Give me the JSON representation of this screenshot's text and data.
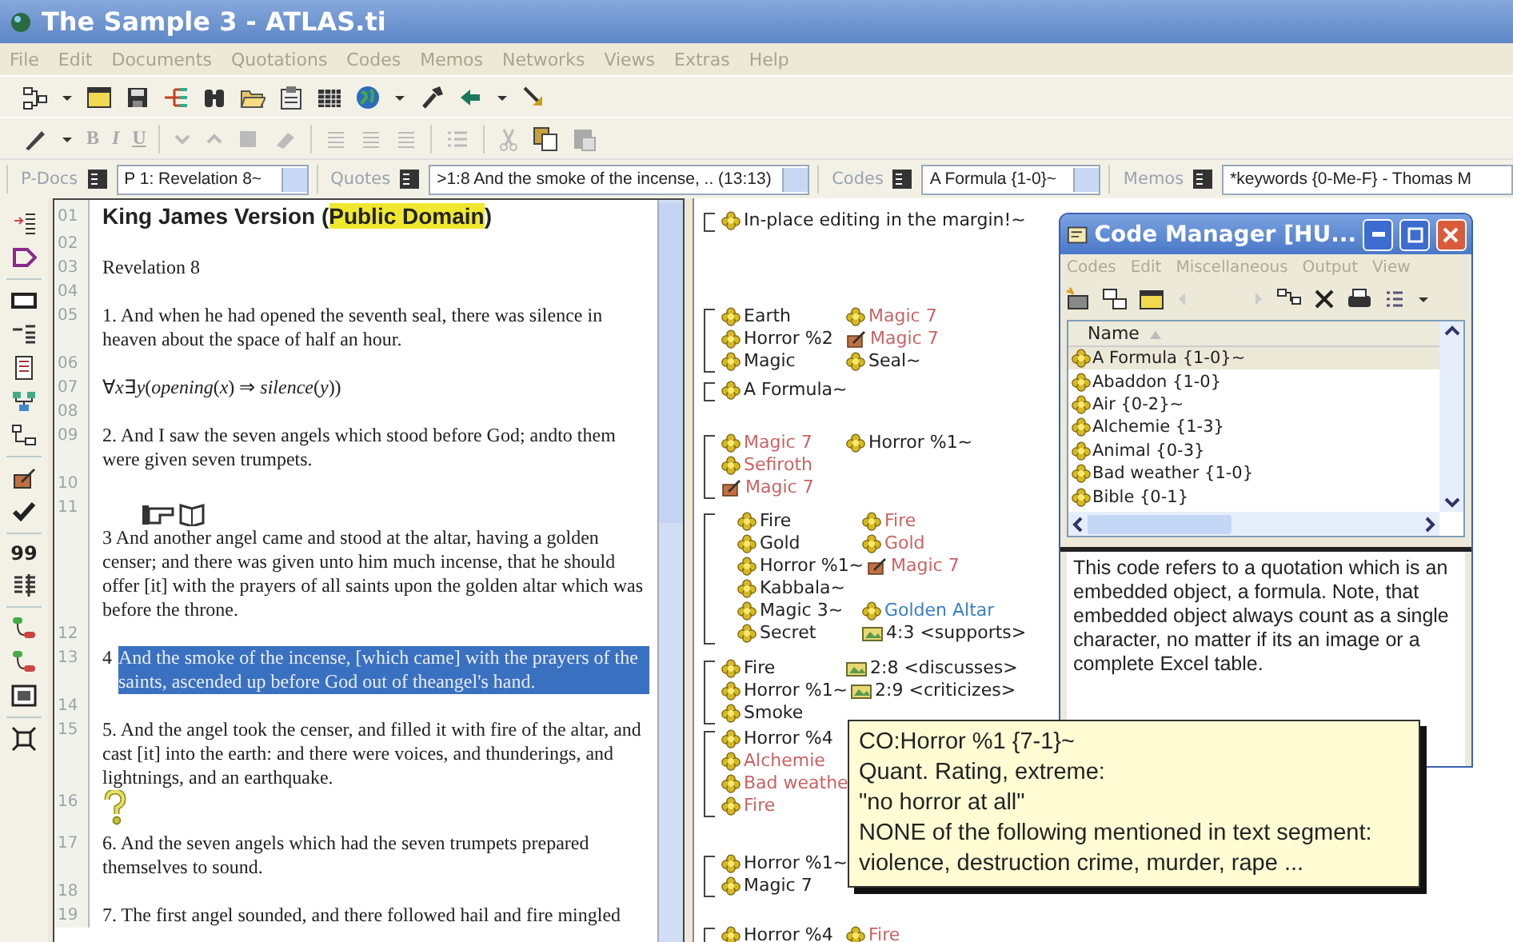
{
  "window": {
    "title": "The Sample 3 - ATLAS.ti"
  },
  "menu": [
    "File",
    "Edit",
    "Documents",
    "Quotations",
    "Codes",
    "Memos",
    "Networks",
    "Views",
    "Extras",
    "Help"
  ],
  "format_buttons": [
    "B",
    "I",
    "U"
  ],
  "selectors": [
    {
      "label": "P-Docs",
      "value": "P 1: Revelation 8~"
    },
    {
      "label": "Quotes",
      "value": ">1:8 And the smoke of the incense, .. (13:13)"
    },
    {
      "label": "Codes",
      "value": "A Formula {1-0}~"
    },
    {
      "label": "Memos",
      "value": "*keywords {0-Me-F} - Thomas M"
    }
  ],
  "side_toolbar_label": "99",
  "document": {
    "lines": [
      {
        "number": "01",
        "kind": "heading",
        "text": "King James Version (",
        "highlight": "Public Domain",
        "text_after": ")"
      },
      {
        "number": "02",
        "kind": "blank"
      },
      {
        "number": "03",
        "kind": "text",
        "text": "Revelation  8"
      },
      {
        "number": "04",
        "kind": "blank"
      },
      {
        "number": "05",
        "kind": "text",
        "text": "1. And when he had opened the seventh seal, there was silence in heaven about the space of half an hour."
      },
      {
        "number": "06",
        "kind": "blank"
      },
      {
        "number": "07",
        "kind": "formula",
        "text": "∀*x*∃*y*(*opening*(*x*) ⇒ *silence*(*y*))"
      },
      {
        "number": "08",
        "kind": "blank"
      },
      {
        "number": "09",
        "kind": "text",
        "text": "2. And I saw the seven angels which stood before God; andto them were given seven trumpets."
      },
      {
        "number": "10",
        "kind": "blank"
      },
      {
        "number": "11",
        "kind": "embedded",
        "verse": "3",
        "text": "And another angel came and stood at the altar, having a golden censer; and there was given unto him much incense, that he should offer [it] with the prayers of all saints upon the golden altar which was before the throne."
      },
      {
        "number": "12",
        "kind": "blank"
      },
      {
        "number": "13",
        "kind": "quotation",
        "verse": "4",
        "text": "And the smoke of the incense, [which came] with the prayers of the saints, ascended up before God out of theangel's hand.",
        "selected": true
      },
      {
        "number": "14",
        "kind": "blank"
      },
      {
        "number": "15",
        "kind": "text",
        "text": "5. And the angel took the censer, and filled it with fire of the altar, and cast [it] into the earth: and there were voices, and thunderings, and lightnings, and an earthquake."
      },
      {
        "number": "16",
        "kind": "icon"
      },
      {
        "number": "17",
        "kind": "text",
        "text": "6. And the seven angels which had the seven trumpets prepared themselves to sound."
      },
      {
        "number": "18",
        "kind": "blank"
      },
      {
        "number": "19",
        "kind": "text",
        "text": "7. The first angel sounded, and there followed hail and fire mingled"
      }
    ]
  },
  "margin": {
    "groups": [
      {
        "rows": [
          [
            {
              "kind": "code",
              "label": "In-place editing in the margin!~",
              "color": "#222222"
            }
          ]
        ]
      },
      {
        "rows": [
          [
            {
              "kind": "code",
              "label": "Earth",
              "color": "#222222"
            },
            {
              "kind": "code",
              "label": "Magic 7",
              "color": "#c86464"
            }
          ],
          [
            {
              "kind": "code",
              "label": "Horror %2",
              "color": "#222222"
            },
            {
              "kind": "memo",
              "label": "Magic 7",
              "color": "#c86464"
            }
          ],
          [
            {
              "kind": "code",
              "label": "Magic",
              "color": "#222222"
            },
            {
              "kind": "code",
              "label": "Seal~",
              "color": "#222222"
            }
          ]
        ]
      },
      {
        "rows": [
          [
            {
              "kind": "code",
              "label": "A Formula~",
              "color": "#222222"
            }
          ]
        ]
      },
      {
        "rows": [
          [
            {
              "kind": "code",
              "label": "Magic 7",
              "color": "#c86464"
            },
            {
              "kind": "code",
              "label": "Horror %1~",
              "color": "#222222"
            }
          ],
          [
            {
              "kind": "code",
              "label": "Sefiroth",
              "color": "#c86464"
            }
          ],
          [
            {
              "kind": "memo",
              "label": "Magic 7",
              "color": "#c86464"
            }
          ]
        ]
      },
      {
        "rows": [
          [
            {
              "kind": "code",
              "label": "Fire",
              "color": "#222222"
            },
            {
              "kind": "code",
              "label": "Fire",
              "color": "#c86464"
            }
          ],
          [
            {
              "kind": "code",
              "label": "Gold",
              "color": "#222222"
            },
            {
              "kind": "code",
              "label": "Gold",
              "color": "#c86464"
            }
          ],
          [
            {
              "kind": "code",
              "label": "Horror %1~",
              "color": "#222222"
            },
            {
              "kind": "memo",
              "label": "Magic 7",
              "color": "#c86464"
            }
          ],
          [
            {
              "kind": "code",
              "label": "Kabbala~",
              "color": "#222222"
            }
          ],
          [
            {
              "kind": "code",
              "label": "Magic 3~",
              "color": "#222222"
            },
            {
              "kind": "code",
              "label": "Golden Altar",
              "color": "#3b7fc4"
            }
          ],
          [
            {
              "kind": "code",
              "label": "Secret",
              "color": "#222222"
            },
            {
              "kind": "link",
              "label": "4:3 <supports>",
              "color": "#222222"
            }
          ]
        ]
      },
      {
        "rows": [
          [
            {
              "kind": "code",
              "label": "Fire",
              "color": "#222222"
            },
            {
              "kind": "link",
              "label": "2:8 <discusses>",
              "color": "#222222"
            }
          ],
          [
            {
              "kind": "code",
              "label": "Horror %1~",
              "color": "#222222"
            },
            {
              "kind": "link",
              "label": "2:9 <criticizes>",
              "color": "#222222"
            }
          ],
          [
            {
              "kind": "code",
              "label": "Smoke",
              "color": "#222222"
            }
          ]
        ]
      },
      {
        "rows": [
          [
            {
              "kind": "code",
              "label": "Horror %4",
              "color": "#222222"
            }
          ],
          [
            {
              "kind": "code",
              "label": "Alchemie",
              "color": "#c86464"
            }
          ],
          [
            {
              "kind": "code",
              "label": "Bad weathe",
              "color": "#c86464"
            }
          ],
          [
            {
              "kind": "code",
              "label": "Fire",
              "color": "#c86464"
            }
          ]
        ]
      },
      {
        "rows": [
          [
            {
              "kind": "code",
              "label": "Horror %1~",
              "color": "#222222"
            }
          ],
          [
            {
              "kind": "code",
              "label": "Magic 7",
              "color": "#222222"
            }
          ]
        ]
      },
      {
        "rows": [
          [
            {
              "kind": "code",
              "label": "Horror %4",
              "color": "#222222"
            },
            {
              "kind": "code",
              "label": "Fire",
              "color": "#c86464"
            }
          ]
        ]
      }
    ]
  },
  "code_manager": {
    "title": "Code Manager [HU...",
    "menu": [
      "Codes",
      "Edit",
      "Miscellaneous",
      "Output",
      "View"
    ],
    "column": "Name",
    "codes": [
      {
        "label": "A Formula {1-0}~",
        "selected": true
      },
      {
        "label": "Abaddon {1-0}",
        "selected": false
      },
      {
        "label": "Air {0-2}~",
        "selected": false
      },
      {
        "label": "Alchemie {1-3}",
        "selected": false
      },
      {
        "label": "Animal {0-3}",
        "selected": false
      },
      {
        "label": "Bad weather {1-0}",
        "selected": false
      },
      {
        "label": "Bible {0-1}",
        "selected": false
      }
    ],
    "comment": "This code refers to a quotation which is an embedded object, a formula. Note, that embedded object always count as a single character, no matter if its an image or a complete Excel table."
  },
  "tooltip": {
    "lines": [
      "CO:Horror %1 {7-1}~",
      "Quant. Rating, extreme:",
      "\"no horror at all\"",
      "NONE of the following mentioned in text segment:",
      "violence, destruction crime, murder, rape ..."
    ]
  }
}
